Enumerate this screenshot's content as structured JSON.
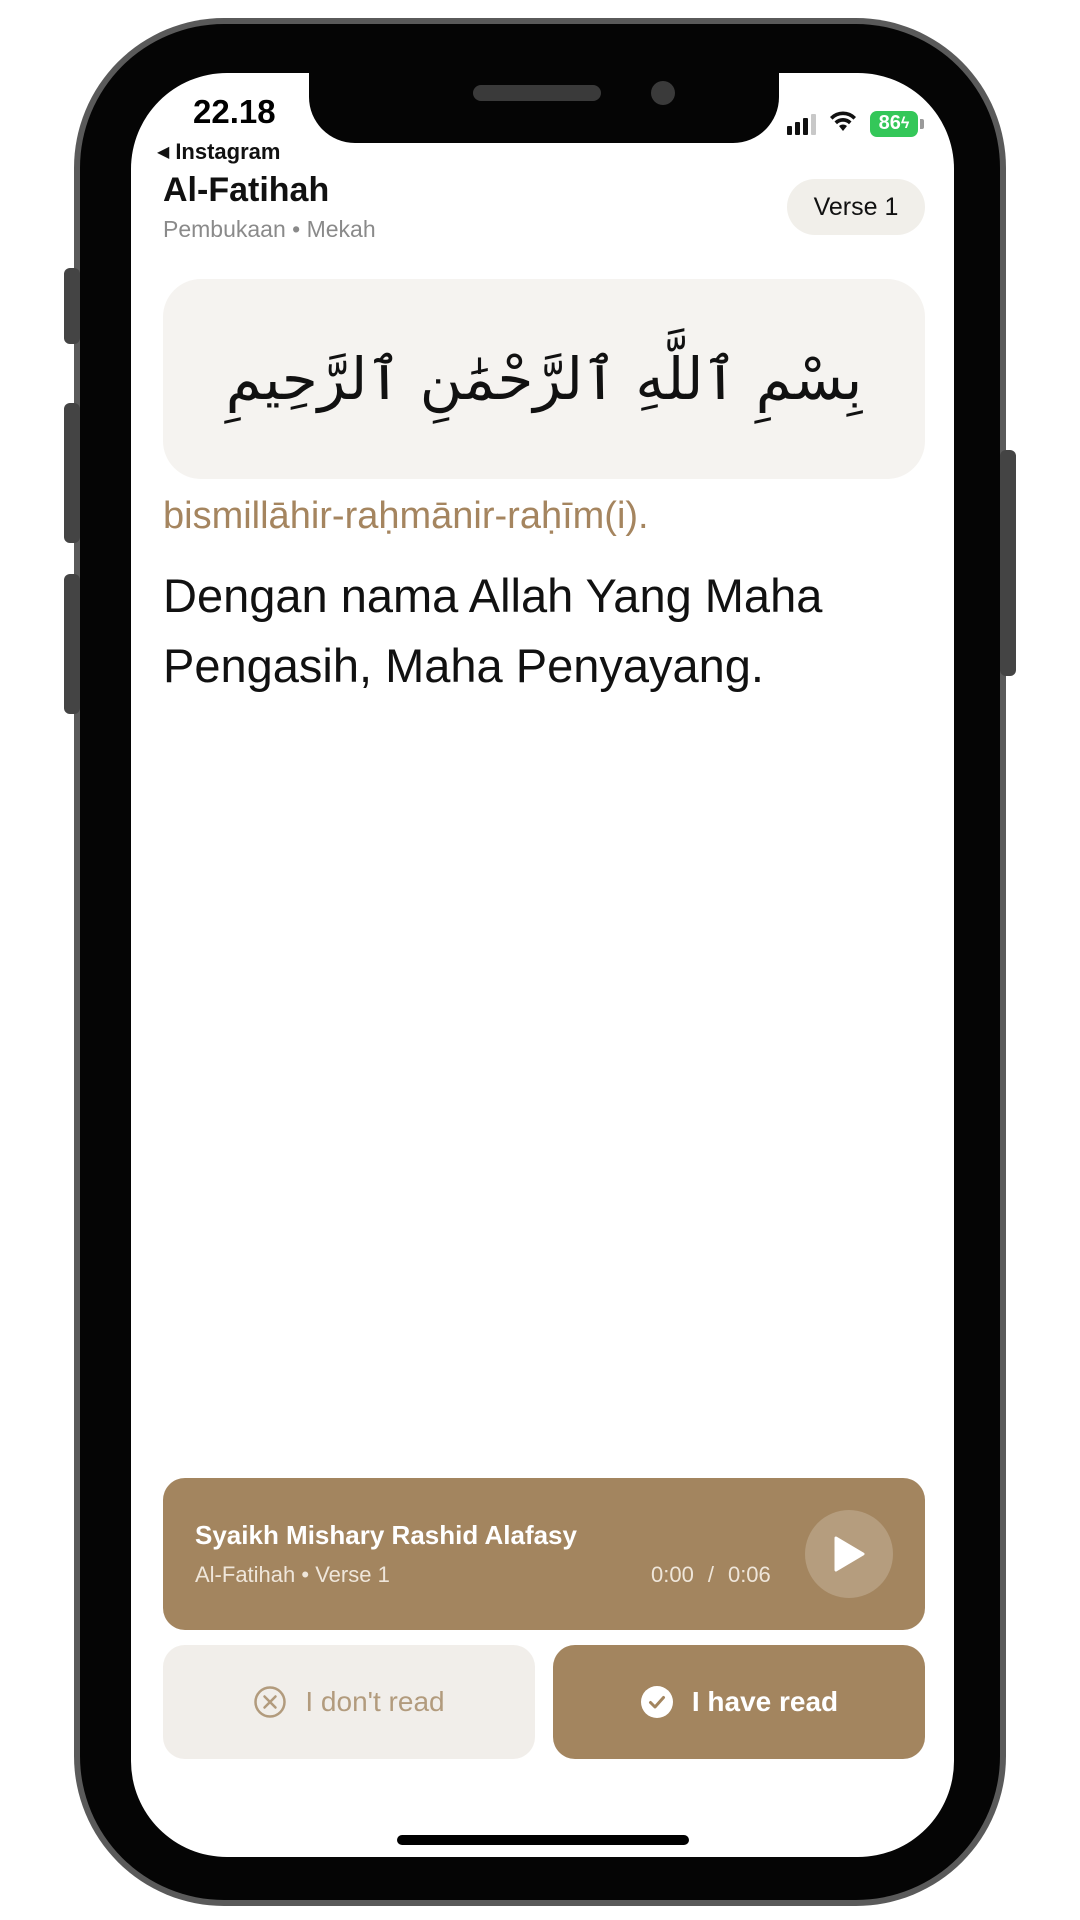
{
  "status_bar": {
    "time": "22.18",
    "back_app": "Instagram",
    "battery": "86"
  },
  "header": {
    "title": "Al-Fatihah",
    "subtitle": "Pembukaan • Mekah",
    "verse_pill": "Verse 1"
  },
  "verse": {
    "arabic": "بِسْمِ ٱللَّهِ ٱلرَّحْمَٰنِ ٱلرَّحِيمِ",
    "latin": "bismillāhir-raḥmānir-raḥīm(i).",
    "translation": "Dengan nama Allah Yang Maha Pengasih, Maha Penyayang."
  },
  "player": {
    "reciter": "Syaikh Mishary Rashid Alafasy",
    "track": "Al-Fatihah • Verse 1",
    "current_time": "0:00",
    "separator": "/",
    "duration": "0:06"
  },
  "actions": {
    "dont_read": "I don't read",
    "have_read": "I have read"
  },
  "colors": {
    "accent": "#a3855f",
    "latin_text": "#a5855f",
    "card_bg": "#f5f3f0",
    "battery": "#34c759"
  },
  "icons": {
    "play": "play-icon",
    "dont_read": "x-circle-icon",
    "have_read": "check-circle-icon",
    "back": "back-triangle-icon"
  }
}
